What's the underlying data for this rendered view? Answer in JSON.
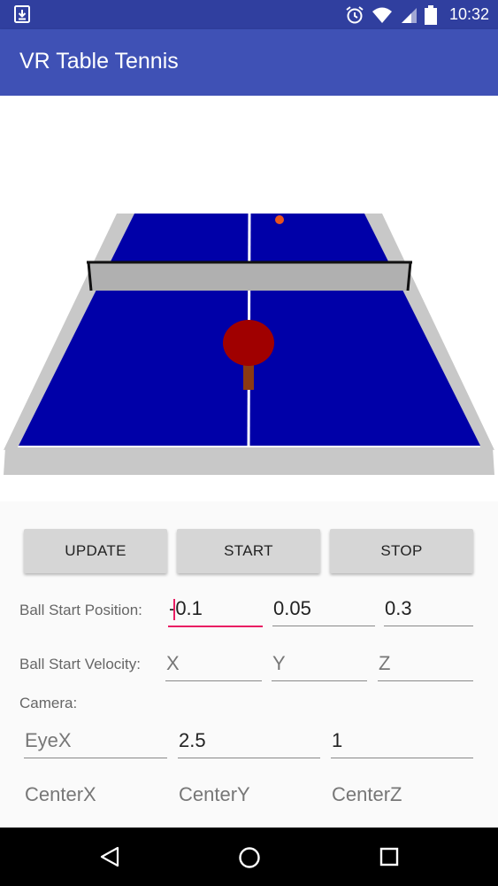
{
  "status_bar": {
    "time": "10:32",
    "icons": [
      "download-icon",
      "alarm-icon",
      "wifi-icon",
      "signal-icon",
      "battery-icon"
    ]
  },
  "app_bar": {
    "title": "VR Table Tennis",
    "color": "#3f51b5"
  },
  "scene": {
    "table_color": "#0000a8",
    "net_color": "#b0b0b0",
    "ball_color": "#e8541e",
    "paddle_color": "#a00000"
  },
  "buttons": {
    "update": "UPDATE",
    "start": "START",
    "stop": "STOP"
  },
  "ball_start_position": {
    "label": "Ball Start Position:",
    "x": "-0.1",
    "y": "0.05",
    "z": "0.3"
  },
  "ball_start_velocity": {
    "label": "Ball Start Velocity:",
    "x_placeholder": "X",
    "y_placeholder": "Y",
    "z_placeholder": "Z"
  },
  "camera": {
    "label": "Camera:",
    "eye_x_placeholder": "EyeX",
    "eye_y": "2.5",
    "eye_z": "1",
    "center_x_placeholder": "CenterX",
    "center_y_placeholder": "CenterY",
    "center_z_placeholder": "CenterZ"
  },
  "nav_bar": {
    "icons": [
      "back-icon",
      "home-icon",
      "recents-icon"
    ]
  }
}
